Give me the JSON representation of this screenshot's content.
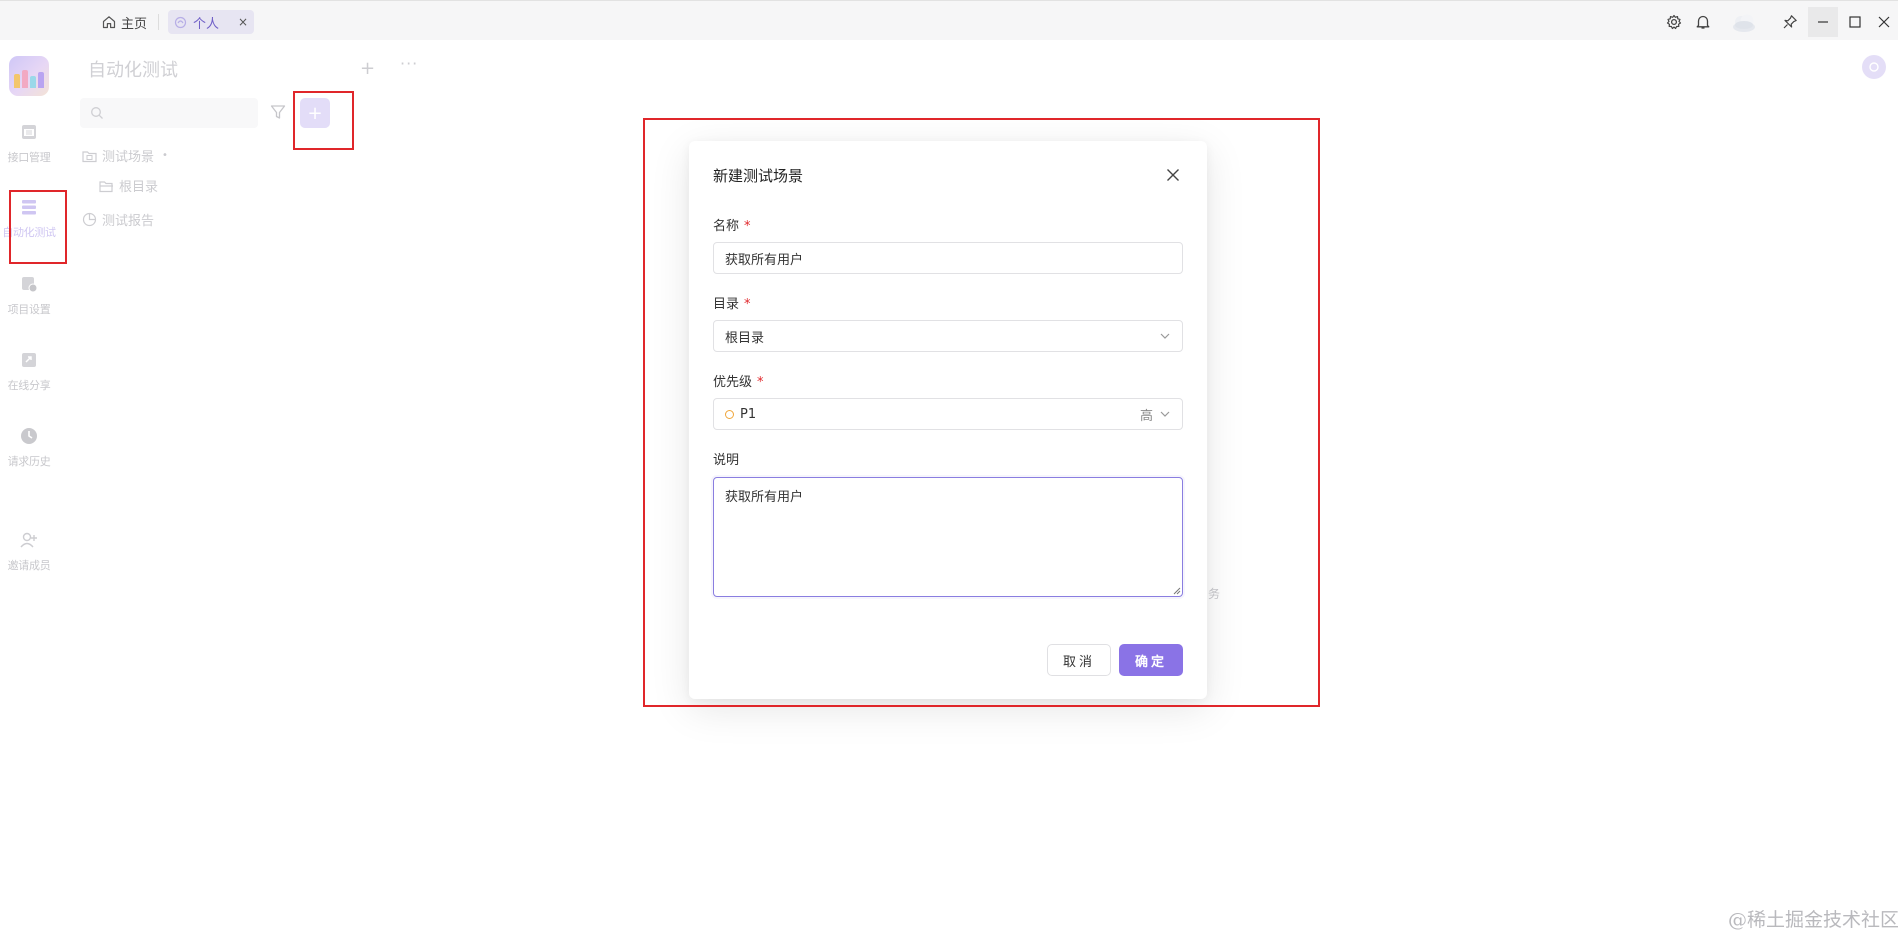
{
  "titlebar": {
    "tabs": [
      {
        "label": "主页",
        "icon": "home-icon",
        "active": false
      },
      {
        "label": "个人",
        "icon": "personal-icon",
        "active": true,
        "close": "×"
      }
    ],
    "window_icons": [
      "settings-icon",
      "bell-icon",
      "user-avatar",
      "pin-icon",
      "minimize-icon",
      "maximize-icon",
      "close-icon"
    ]
  },
  "rail": {
    "items": [
      {
        "label": "接口管理",
        "icon": "api-icon",
        "active": false
      },
      {
        "label": "自动化测试",
        "icon": "automation-icon",
        "active": true
      },
      {
        "label": "项目设置",
        "icon": "project-settings-icon",
        "active": false
      },
      {
        "label": "在线分享",
        "icon": "share-icon",
        "active": false
      },
      {
        "label": "请求历史",
        "icon": "history-icon",
        "active": false
      },
      {
        "label": "邀请成员",
        "icon": "invite-icon",
        "active": false
      }
    ]
  },
  "panel": {
    "title": "自动化测试",
    "add": "+",
    "more": "···",
    "search_placeholder": "",
    "new_button": "+",
    "tree": [
      {
        "label": "测试场景",
        "icon": "folder-icon",
        "suffix": "•"
      },
      {
        "label": "根目录",
        "icon": "folder-open-icon"
      },
      {
        "label": "测试报告",
        "icon": "report-icon"
      }
    ]
  },
  "modal": {
    "title": "新建测试场景",
    "close": "×",
    "fields": {
      "name": {
        "label": "名称",
        "required": "*",
        "value": "获取所有用户"
      },
      "directory": {
        "label": "目录",
        "required": "*",
        "value": "根目录"
      },
      "priority": {
        "label": "优先级",
        "required": "*",
        "value": "P1",
        "tag": "高",
        "dot_color": "#f0a63a"
      },
      "description": {
        "label": "说明",
        "value": "获取所有用户"
      }
    },
    "cancel_label": "取消",
    "ok_label": "确定"
  },
  "stray_text": "务",
  "watermark": "@稀土掘金技术社区",
  "colors": {
    "accent": "#8a73e6",
    "required": "#e0262a",
    "annotation": "#e0262a"
  }
}
